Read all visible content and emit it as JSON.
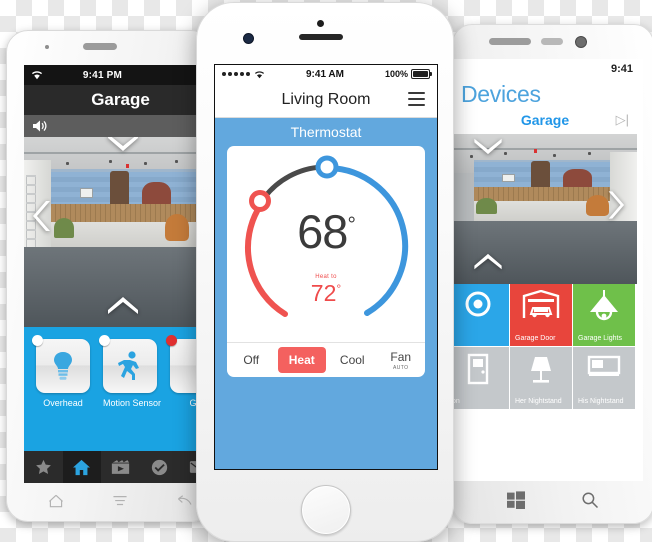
{
  "scene_description": "Three smartphones showing a home-automation app: Android (left) garage camera view, iPhone (center, front) thermostat screen, Windows Phone (right) devices tile screen.",
  "android": {
    "device_name": "android-phone",
    "status_bar": {
      "time": "9:41 PM",
      "wifi_icon": "wifi-icon"
    },
    "title": "Garage",
    "camera_row": {
      "speaker_icon": "speaker-icon"
    },
    "controls": {
      "left_chevron": "chevron-left-icon",
      "up_chevron": "chevron-up-icon",
      "down_chevron": "chevron-down-icon"
    },
    "tiles": [
      {
        "label": "Overhead",
        "icon": "light-bulb-icon",
        "indicator": "off"
      },
      {
        "label": "Motion Sensor",
        "icon": "running-person-icon",
        "indicator": "off"
      },
      {
        "label": "Gar",
        "icon": "garage-icon",
        "indicator": "on"
      }
    ],
    "tab_bar": [
      {
        "name": "favorites",
        "icon": "star-icon",
        "selected": false
      },
      {
        "name": "home",
        "icon": "home-icon",
        "selected": true
      },
      {
        "name": "scenes",
        "icon": "film-icon",
        "selected": false
      },
      {
        "name": "tasks",
        "icon": "check-circle-icon",
        "selected": false
      },
      {
        "name": "messages",
        "icon": "mail-icon",
        "selected": false
      }
    ],
    "system_nav": [
      {
        "name": "home",
        "icon": "home-outline-icon"
      },
      {
        "name": "menu",
        "icon": "menu-icon"
      },
      {
        "name": "back",
        "icon": "back-arrow-icon"
      }
    ],
    "accent_color": "#1aa3e2"
  },
  "iphone": {
    "device_name": "iphone",
    "status_bar": {
      "signal_dots": 5,
      "wifi_icon": "wifi-icon",
      "time": "9:41 AM",
      "battery_percent": "100%",
      "battery_icon": "battery-full-icon"
    },
    "nav_title": "Living Room",
    "menu_icon": "hamburger-menu-icon",
    "section_title": "Thermostat",
    "thermostat": {
      "current_temp": "68",
      "degree_symbol": "°",
      "setpoint_label": "Heat to",
      "setpoint_temp": "72",
      "cool_arc_color": "#3d96dd",
      "heat_arc_color": "#ef5350",
      "dim_arc_color": "#4a4a4a"
    },
    "modes": [
      {
        "label": "Off",
        "selected": false,
        "sub": ""
      },
      {
        "label": "Heat",
        "selected": true,
        "sub": ""
      },
      {
        "label": "Cool",
        "selected": false,
        "sub": ""
      },
      {
        "label": "Fan",
        "selected": false,
        "sub": "AUTO"
      }
    ],
    "accent_color": "#62a8de",
    "highlight_color": "#f4615f"
  },
  "winphone": {
    "device_name": "windows-phone",
    "status_bar": {
      "time": "9:41"
    },
    "header": "Devices",
    "pivot": {
      "label": "Garage",
      "next_icon": "next-pivot-icon"
    },
    "controls": {
      "up_chevron": "chevron-up-icon",
      "right_chevron": "chevron-right-icon",
      "down_chevron": "chevron-down-icon"
    },
    "tiles": [
      {
        "label": "",
        "icon": "nest-icon",
        "color": "#2ba6e8"
      },
      {
        "label": "Garage Door",
        "icon": "garage-door-car-icon",
        "color": "#e8453c"
      },
      {
        "label": "Garage Lights",
        "icon": "pendant-lamp-icon",
        "color": "#6fc04a"
      },
      {
        "label": "on",
        "icon": "door-icon",
        "color": "#c4c8cb"
      },
      {
        "label": "Her Nightstand",
        "icon": "table-lamp-icon",
        "color": "#c4c8cb"
      },
      {
        "label": "His Nightstand",
        "icon": "bed-icon",
        "color": "#c4c8cb"
      }
    ],
    "system_nav": [
      {
        "name": "windows-start",
        "icon": "windows-logo-icon"
      },
      {
        "name": "search",
        "icon": "search-icon"
      }
    ],
    "accent_color": "#2196e8"
  }
}
